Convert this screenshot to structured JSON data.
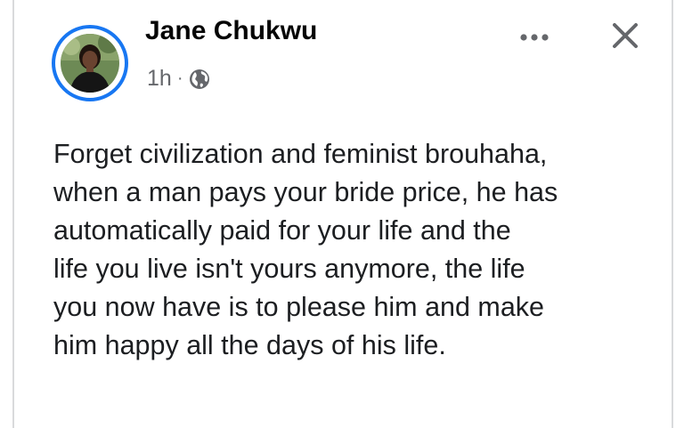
{
  "post": {
    "author_name": "Jane Chukwu",
    "timestamp": "1h",
    "separator": "·",
    "privacy_icon": "globe-icon",
    "more_icon": "more-options-icon",
    "close_icon": "close-icon",
    "lines": [
      "Forget civilization and feminist brouhaha,",
      "when a man pays your bride price, he has",
      "automatically paid for your life and the",
      "life you live isn't yours anymore, the life",
      "you now have is to please him and make",
      "him happy all the days of his life."
    ]
  },
  "colors": {
    "story_ring": "#1877f2",
    "name_text": "#050505",
    "meta_text": "#65676b",
    "body_text": "#1c1e21",
    "border": "#d9dadc"
  }
}
